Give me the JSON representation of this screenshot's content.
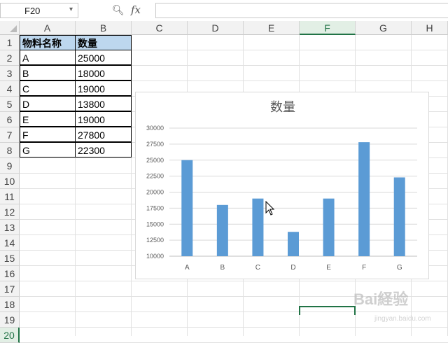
{
  "formula_bar": {
    "name_box": "F20",
    "fx_label": "fx",
    "formula": ""
  },
  "columns": [
    "A",
    "B",
    "C",
    "D",
    "E",
    "F",
    "G",
    "H"
  ],
  "rows": [
    "1",
    "2",
    "3",
    "4",
    "5",
    "6",
    "7",
    "8",
    "9",
    "10",
    "11",
    "12",
    "13",
    "14",
    "15",
    "16",
    "17",
    "18",
    "19",
    "20"
  ],
  "selected_column": "F",
  "selected_row": "20",
  "table": {
    "headers": [
      "物料名称",
      "数量"
    ],
    "rows": [
      [
        "A",
        "25000"
      ],
      [
        "B",
        "18000"
      ],
      [
        "C",
        "19000"
      ],
      [
        "D",
        "13800"
      ],
      [
        "E",
        "19000"
      ],
      [
        "F",
        "27800"
      ],
      [
        "G",
        "22300"
      ]
    ]
  },
  "chart_data": {
    "type": "bar",
    "title": "数量",
    "categories": [
      "A",
      "B",
      "C",
      "D",
      "E",
      "F",
      "G"
    ],
    "values": [
      25000,
      18000,
      19000,
      13800,
      19000,
      27800,
      22300
    ],
    "ylim": [
      10000,
      30000
    ],
    "yticks": [
      "10000",
      "12500",
      "15000",
      "17500",
      "20000",
      "22500",
      "25000",
      "27500",
      "30000"
    ],
    "bar_color": "#5b9bd5",
    "grid": true,
    "legend": "none"
  },
  "watermark": {
    "main": "Bai経验",
    "sub": "jingyan.baidu.com"
  }
}
